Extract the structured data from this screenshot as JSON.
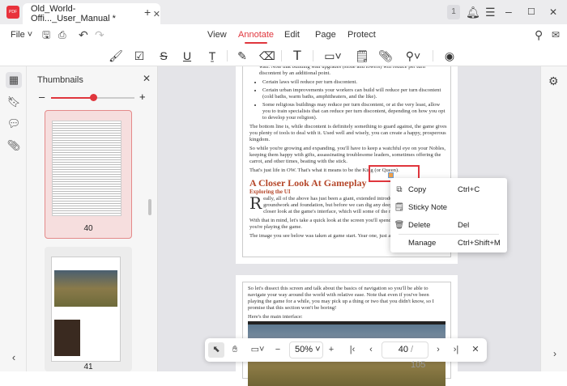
{
  "window": {
    "tab_title": "Old_World-Offi..._User_Manual *",
    "notif_count": "1"
  },
  "menu": {
    "file": "File",
    "tabs": [
      "View",
      "Annotate",
      "Edit",
      "Page",
      "Protect"
    ],
    "active": "Annotate"
  },
  "thumbnails": {
    "title": "Thumbnails",
    "zoom_fraction": 0.5,
    "pages": [
      {
        "num": "40",
        "selected": true
      },
      {
        "num": "41",
        "selected": false
      }
    ]
  },
  "document": {
    "top_line": "wall. Note that building wall upgrades (stone and towers) will reduce per turn discontent by an additional point.",
    "bullets": [
      "Certain laws will reduce per turn discontent.",
      "Certain urban improvements your workers can build will reduce per turn discontent (cold baths, warm baths, amphitheaters, and the like).",
      "Some religious buildings may reduce per turn discontent, or at the very least, allow you to train specialists that can reduce per turn discontent, depending on how you opt to develop your religion)."
    ],
    "para1": "The bottom line is, while discontent is definitely something to guard against, the game gives you plenty of tools to deal with it.  Used well and wisely, you can create a happy, prosperous kingdom.",
    "para2": "So while you're growing and expanding, you'll have to keep a watchful eye on your Nobles, keeping them happy with gifts, assassinating troublesome leaders, sometimes offering the carrot, and other times, beating with the stick.",
    "para3": "That's just life in OW.  That's what it means to be the King (or Queen).",
    "heading": "A Closer Look At Gameplay",
    "subheading": "Exploring the UI",
    "dropcap": "R",
    "para4": "eally, all of the above has just been a giant, extended introduction. The the groundwork and foundation, but before we can dig any deeper, a moment and take a closer look at the game's interface, which will some of the material that comes later.",
    "para5": "With that in mind, let's take a quick look at the screen you'll spend the va looking at while you're playing the game.",
    "para6": "The image you see below was taken at game start.  Year one, just after fou",
    "page2_para": "So let's dissect this screen and talk about the basics of navigation so you'll be able to navigate your way around the world with relative ease.  Note that even if you've been playing the game for a while, you may pick up a thing or two that you didn't know, so I promise that this section won't be boring!",
    "page2_caption": "Here's the main interface:"
  },
  "context_menu": [
    {
      "label": "Copy",
      "shortcut": "Ctrl+C"
    },
    {
      "label": "Sticky Note",
      "shortcut": ""
    },
    {
      "label": "Delete",
      "shortcut": "Del"
    },
    {
      "label": "Manage",
      "shortcut": "Ctrl+Shift+M"
    }
  ],
  "bottom_bar": {
    "zoom": "50%",
    "current_page": "40",
    "total_pages": "/ 105"
  },
  "colors": {
    "accent": "#e0363d",
    "heading": "#b5472a"
  }
}
